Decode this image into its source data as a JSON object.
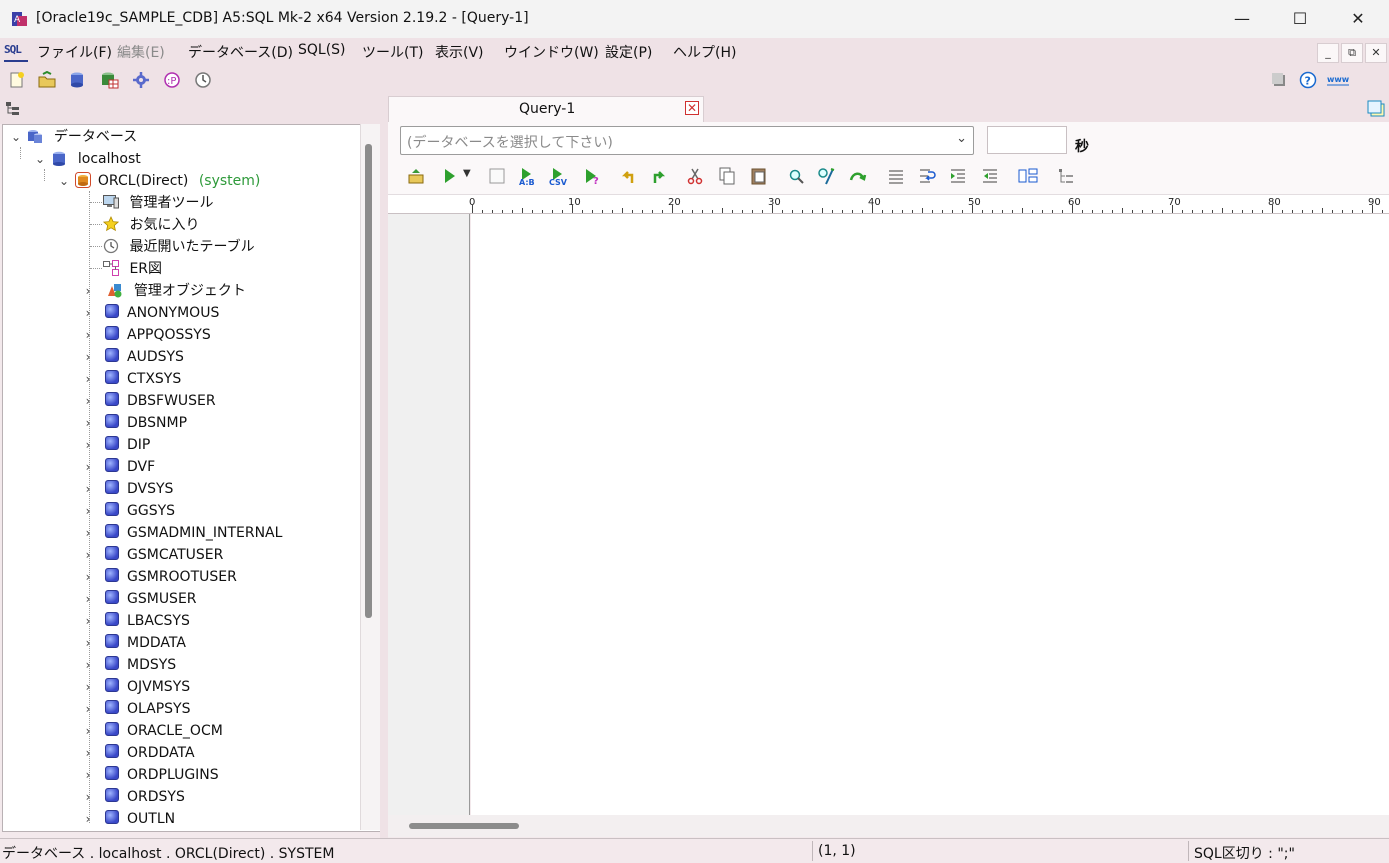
{
  "window": {
    "title": "[Oracle19c_SAMPLE_CDB] A5:SQL Mk-2 x64 Version 2.19.2 - [Query-1]",
    "minimize": "—",
    "maximize": "☐",
    "close": "✕"
  },
  "menu": {
    "logo": "SQL",
    "items": [
      "ファイル(F)",
      "編集(E)",
      "データベース(D)",
      "SQL(S)",
      "ツール(T)",
      "表示(V)",
      "ウインドウ(W)",
      "設定(P)",
      "ヘルプ(H)"
    ],
    "mdi_buttons": [
      "_",
      "⧉",
      "✕"
    ]
  },
  "tree": {
    "root": "データベース",
    "host": "localhost",
    "connection": "ORCL(Direct)",
    "connection_user": "(system)",
    "fixed_nodes": [
      "管理者ツール",
      "お気に入り",
      "最近開いたテーブル",
      "ER図",
      "管理オブジェクト"
    ],
    "schemas": [
      "ANONYMOUS",
      "APPQOSSYS",
      "AUDSYS",
      "CTXSYS",
      "DBSFWUSER",
      "DBSNMP",
      "DIP",
      "DVF",
      "DVSYS",
      "GGSYS",
      "GSMADMIN_INTERNAL",
      "GSMCATUSER",
      "GSMROOTUSER",
      "GSMUSER",
      "LBACSYS",
      "MDDATA",
      "MDSYS",
      "OJVMSYS",
      "OLAPSYS",
      "ORACLE_OCM",
      "ORDDATA",
      "ORDPLUGINS",
      "ORDSYS",
      "OUTLN"
    ]
  },
  "query_tab": {
    "label": "Query-1",
    "close": "✕"
  },
  "editor": {
    "database_placeholder": "(データベースを選択して下さい)",
    "seconds_value": "",
    "seconds_label": "秒",
    "ruler_numbers": [
      "0",
      "10",
      "20",
      "30",
      "40",
      "50",
      "60",
      "70",
      "80",
      "90"
    ]
  },
  "status": {
    "path": "データベース . localhost . ORCL(Direct) . SYSTEM",
    "cursor": "(1, 1)",
    "delimiter": "SQL区切り : \";\""
  },
  "colors": {
    "chrome_bg": "#efe2e6",
    "schema_icon": "#3948c8",
    "connection_user": "#2e9a3a",
    "tab_close": "#d03030"
  }
}
